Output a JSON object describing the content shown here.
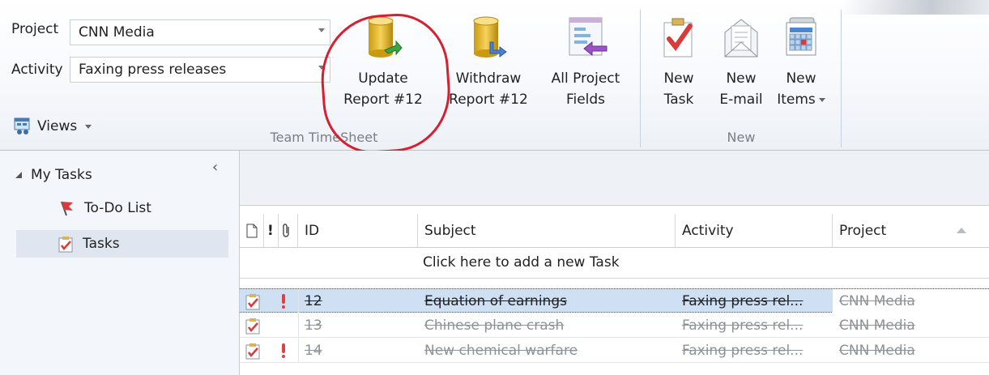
{
  "ribbon": {
    "project_label": "Project",
    "project_value": "CNN Media",
    "activity_label": "Activity",
    "activity_value": "Faxing press releases",
    "views_label": "Views",
    "team_timesheet_group_label": "Team TimeSheet",
    "new_group_label": "New",
    "buttons": {
      "update_line1": "Update",
      "update_line2": "Report #12",
      "withdraw_line1": "Withdraw",
      "withdraw_line2": "Report #12",
      "fields_line1": "All Project",
      "fields_line2": "Fields",
      "new_task_line1": "New",
      "new_task_line2": "Task",
      "new_email_line1": "New",
      "new_email_line2": "E-mail",
      "new_items_line1": "New",
      "new_items_line2": "Items"
    },
    "highlight_color": "#d62030"
  },
  "nav": {
    "my_tasks": "My Tasks",
    "todo": "To-Do List",
    "tasks": "Tasks"
  },
  "grid": {
    "columns": {
      "id": "ID",
      "subject": "Subject",
      "activity": "Activity",
      "project": "Project"
    },
    "add_new_prompt": "Click here to add a new Task",
    "rows": [
      {
        "id": "12",
        "subject": "Equation of earnings ",
        "activity": "Faxing press rel...",
        "project": "CNN Media",
        "flag": true,
        "selected": true
      },
      {
        "id": "13",
        "subject": "Chinese plane crash ",
        "activity": "Faxing press rel...",
        "project": "CNN Media",
        "flag": false,
        "selected": false
      },
      {
        "id": "14",
        "subject": "New chemical warfare ",
        "activity": "Faxing press rel...",
        "project": "CNN Media",
        "flag": true,
        "selected": false
      }
    ]
  },
  "icons": {
    "update": "database-arrow-icon",
    "withdraw": "database-withdraw-icon",
    "fields": "fields-icon",
    "new_task": "task-checkbox-icon",
    "new_email": "envelope-icon",
    "new_items": "calendar-items-icon"
  }
}
